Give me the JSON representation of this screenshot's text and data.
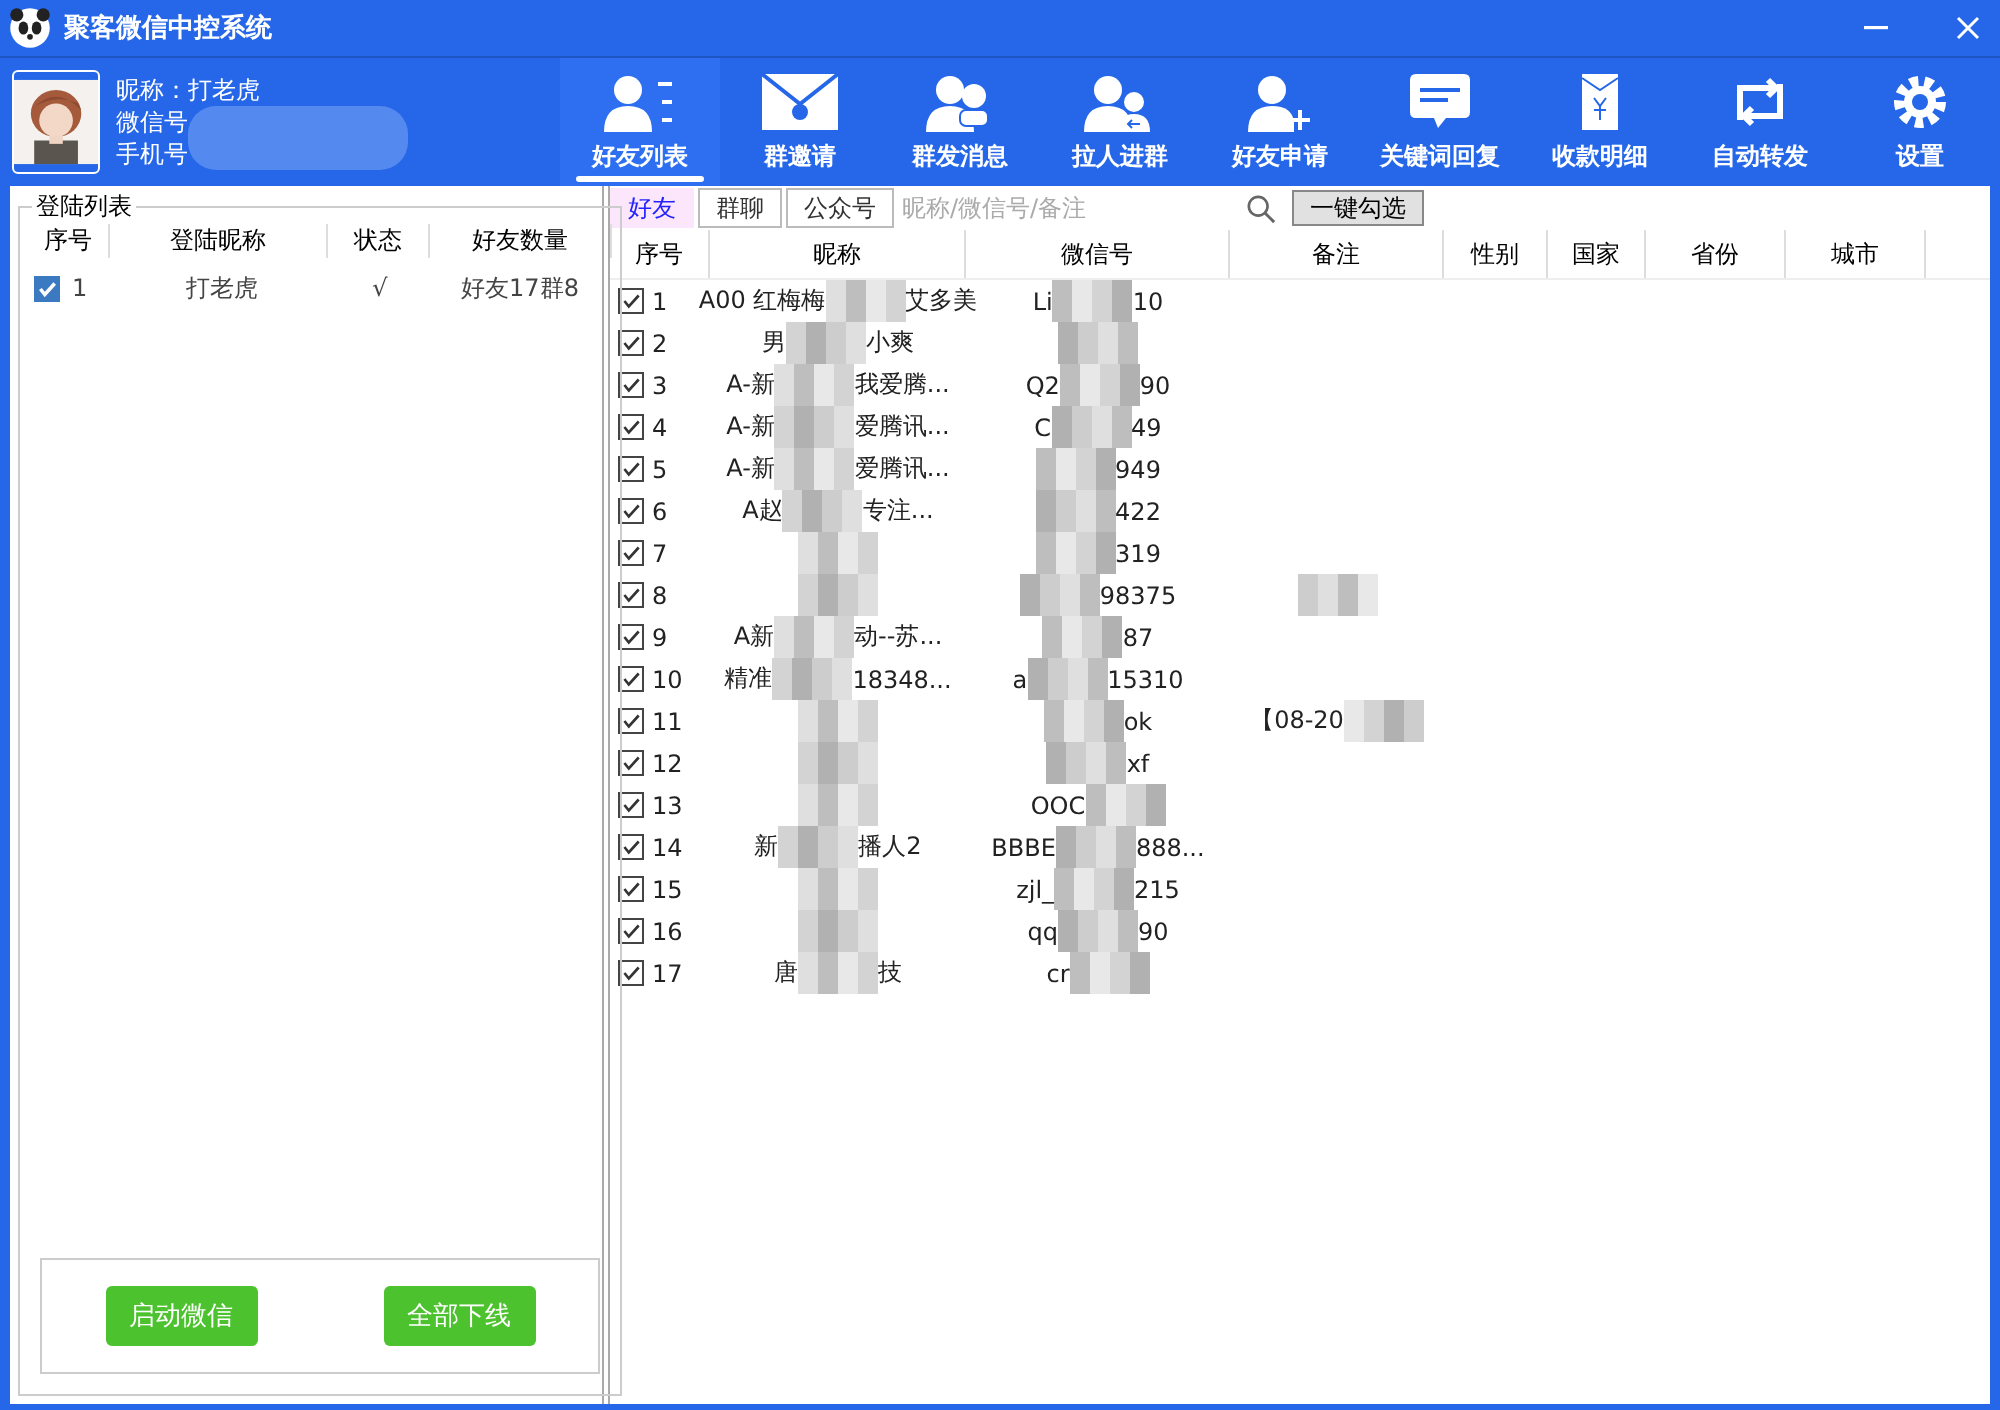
{
  "window": {
    "title": "聚客微信中控系统"
  },
  "profile": {
    "nickname": "昵称：打老虎",
    "wechat_label": "微信号",
    "phone_label": "手机号"
  },
  "toolbar": [
    {
      "label": "好友列表",
      "selected": true
    },
    {
      "label": "群邀请",
      "selected": false
    },
    {
      "label": "群发消息",
      "selected": false
    },
    {
      "label": "拉人进群",
      "selected": false
    },
    {
      "label": "好友申请",
      "selected": false
    },
    {
      "label": "关键词回复",
      "selected": false
    },
    {
      "label": "收款明细",
      "selected": false
    },
    {
      "label": "自动转发",
      "selected": false
    },
    {
      "label": "设置",
      "selected": false
    }
  ],
  "login_list": {
    "title": "登陆列表",
    "columns": [
      "序号",
      "登陆昵称",
      "状态",
      "好友数量"
    ],
    "rows": [
      {
        "index": "1",
        "checked": true,
        "nickname": "打老虎",
        "status": "√",
        "count": "好友17群8"
      }
    ]
  },
  "buttons": [
    "启动微信",
    "全部下线"
  ],
  "tabs": [
    {
      "label": "好友",
      "selected": true
    },
    {
      "label": "群聊",
      "selected": false
    },
    {
      "label": "公众号",
      "selected": false
    }
  ],
  "search": {
    "placeholder": "昵称/微信号/备注"
  },
  "select_all": "一键勾选",
  "table": {
    "columns": [
      "序号",
      "昵称",
      "微信号",
      "备注",
      "性别",
      "国家",
      "省份",
      "城市"
    ],
    "rows": [
      {
        "index": "1",
        "checked": true,
        "nick": {
          "before": "A00 红梅梅",
          "after": "艾多美"
        },
        "wxid": {
          "before": "Li",
          "after": "10"
        }
      },
      {
        "index": "2",
        "checked": true,
        "nick": {
          "before": "男",
          "after": "小爽"
        },
        "wxid": {
          "redacted": true
        }
      },
      {
        "index": "3",
        "checked": true,
        "nick": {
          "before": "A-新",
          "after": "我爱腾..."
        },
        "wxid": {
          "before": "Q2",
          "after": "90"
        }
      },
      {
        "index": "4",
        "checked": true,
        "nick": {
          "before": "A-新",
          "after": "爱腾讯..."
        },
        "wxid": {
          "before": "C",
          "after": "49"
        }
      },
      {
        "index": "5",
        "checked": true,
        "nick": {
          "before": "A-新",
          "after": "爱腾讯..."
        },
        "wxid": {
          "after": "949"
        }
      },
      {
        "index": "6",
        "checked": true,
        "nick": {
          "before": "A赵",
          "after": "专注..."
        },
        "wxid": {
          "after": "422"
        }
      },
      {
        "index": "7",
        "checked": true,
        "nick": {
          "redacted": true
        },
        "wxid": {
          "after": "319"
        }
      },
      {
        "index": "8",
        "checked": true,
        "nick": {
          "redacted": true
        },
        "wxid": {
          "after": "98375"
        },
        "remark": {
          "redacted": true
        }
      },
      {
        "index": "9",
        "checked": true,
        "nick": {
          "before": "A新",
          "after": "动--苏..."
        },
        "wxid": {
          "after": "87"
        }
      },
      {
        "index": "10",
        "checked": true,
        "nick": {
          "before": "精准",
          "after": "18348..."
        },
        "wxid": {
          "before": "a",
          "after": "15310"
        }
      },
      {
        "index": "11",
        "checked": true,
        "nick": {
          "redacted": true
        },
        "wxid": {
          "after": "ok"
        },
        "remark": {
          "before": "【08-20"
        }
      },
      {
        "index": "12",
        "checked": true,
        "nick": {
          "redacted": true
        },
        "wxid": {
          "after": "xf"
        }
      },
      {
        "index": "13",
        "checked": true,
        "nick": {
          "redacted": true
        },
        "wxid": {
          "before": "OOC"
        }
      },
      {
        "index": "14",
        "checked": true,
        "nick": {
          "before": "新",
          "after": "播人2"
        },
        "wxid": {
          "before": "BBBE",
          "after": "888..."
        }
      },
      {
        "index": "15",
        "checked": true,
        "nick": {
          "redacted": true
        },
        "wxid": {
          "before": "zjl_",
          "after": "215"
        }
      },
      {
        "index": "16",
        "checked": true,
        "nick": {
          "redacted": true
        },
        "wxid": {
          "before": "qq",
          "after": "90"
        }
      },
      {
        "index": "17",
        "checked": true,
        "nick": {
          "before": "唐",
          "after": "技"
        },
        "wxid": {
          "before": "cr"
        }
      }
    ]
  }
}
